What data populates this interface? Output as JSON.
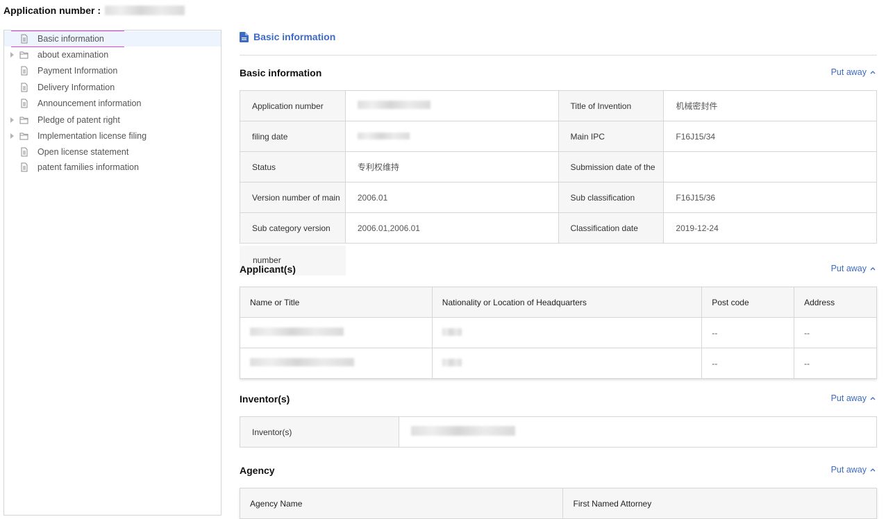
{
  "header": {
    "label": "Application number :"
  },
  "sidebar": {
    "items": [
      {
        "label": "Basic information",
        "type": "file",
        "expandable": false,
        "active": true
      },
      {
        "label": "about examination",
        "type": "folder",
        "expandable": true,
        "active": false
      },
      {
        "label": "Payment Information",
        "type": "file",
        "expandable": false,
        "active": false
      },
      {
        "label": "Delivery Information",
        "type": "file",
        "expandable": false,
        "active": false
      },
      {
        "label": "Announcement information",
        "type": "file",
        "expandable": false,
        "active": false
      },
      {
        "label": "Pledge of patent right",
        "type": "folder",
        "expandable": true,
        "active": false
      },
      {
        "label": "Implementation license filing",
        "type": "folder",
        "expandable": true,
        "active": false
      },
      {
        "label": "Open license statement",
        "type": "file",
        "expandable": false,
        "active": false
      },
      {
        "label": "patent families information",
        "type": "file",
        "expandable": false,
        "active": false
      }
    ]
  },
  "main": {
    "page_title": "Basic information",
    "collapse_label": "Put away",
    "basic": {
      "title": "Basic information",
      "rows": [
        {
          "k1": "Application number",
          "v1": "",
          "k2": "Title of Invention",
          "v2": "机械密封件"
        },
        {
          "k1": "filing date",
          "v1": "",
          "k2": "Main IPC",
          "v2": "F16J15/34"
        },
        {
          "k1": "Status",
          "v1": "专利权维持",
          "k2": "Submission date of the",
          "v2": ""
        },
        {
          "k1": "Version number of main",
          "v1": "2006.01",
          "k2": "Sub classification",
          "v2": "F16J15/36"
        },
        {
          "k1": "Sub category version",
          "v1": "2006.01,2006.01",
          "k2": "Classification date",
          "v2": "2019-12-24"
        }
      ],
      "overflow_text": "number"
    },
    "applicants": {
      "title": "Applicant(s)",
      "headers": [
        "Name or Title",
        "Nationality or Location of Headquarters",
        "Post code",
        "Address"
      ],
      "rows": [
        {
          "post": "--",
          "address": "--"
        },
        {
          "post": "--",
          "address": "--"
        }
      ]
    },
    "inventors": {
      "title": "Inventor(s)",
      "label": "Inventor(s)"
    },
    "agency": {
      "title": "Agency",
      "headers": [
        "Agency Name",
        "First Named Attorney"
      ]
    }
  },
  "colors": {
    "accent": "#3d6bc4",
    "highlight": "#e040e8",
    "active_bg": "#eef4fd"
  }
}
